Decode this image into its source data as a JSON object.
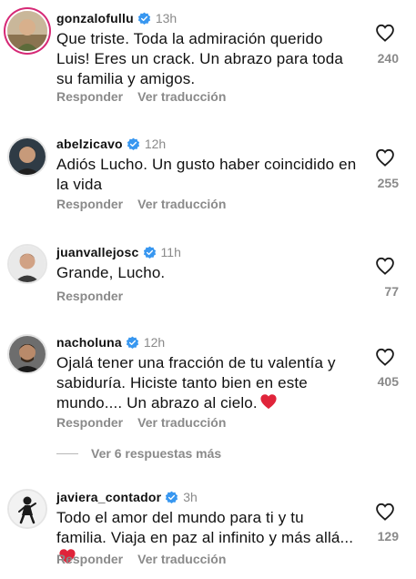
{
  "comments": [
    {
      "username": "gonzalofullu",
      "time": "13h",
      "text": "Que triste. Toda la admiración querido Luis! Eres un crack. Un abrazo para toda su familia y amigos.",
      "likes": "240",
      "reply_label": "Responder",
      "translate_label": "Ver traducción"
    },
    {
      "username": "abelzicavo",
      "time": "12h",
      "text": "Adiós Lucho. Un gusto haber coincidido en la vida",
      "likes": "255",
      "reply_label": "Responder",
      "translate_label": "Ver traducción"
    },
    {
      "username": "juanvallejosc",
      "time": "11h",
      "text": "Grande, Lucho.",
      "likes": "77",
      "reply_label": "Responder"
    },
    {
      "username": "nacholuna",
      "time": "12h",
      "text": "Ojalá tener una fracción de tu valentía y sabiduría. Hiciste tanto bien en este mundo.... Un abrazo al cielo.",
      "likes": "405",
      "reply_label": "Responder",
      "translate_label": "Ver traducción",
      "view_replies_label": "Ver 6 respuestas más"
    },
    {
      "username": "javiera_contador",
      "time": "3h",
      "text": "Todo el amor del mundo para ti y tu familia. Viaja en paz al infinito y más allá...",
      "likes": "129",
      "reply_label": "Responder",
      "translate_label": "Ver traducción"
    }
  ],
  "icons": {
    "verified": "verified-badge-icon",
    "like": "heart-outline-icon",
    "emoji": "red-heart-emoji"
  },
  "colors": {
    "text": "#111111",
    "meta": "#8a8a8a",
    "verified": "#3897f0",
    "story_ring": "#d62976",
    "emoji_heart": "#e0243a"
  }
}
